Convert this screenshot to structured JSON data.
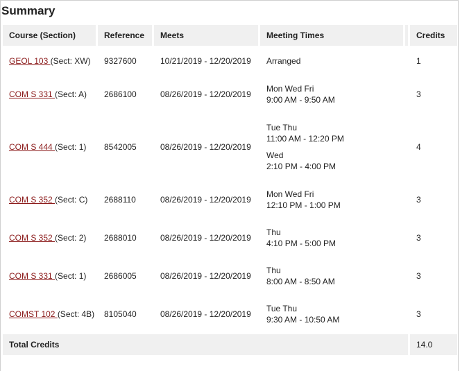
{
  "summary": {
    "title": "Summary",
    "columns": {
      "course": "Course (Section)",
      "reference": "Reference",
      "meets": "Meets",
      "meeting_times": "Meeting Times",
      "credits": "Credits"
    },
    "rows": [
      {
        "course": "GEOL 103 ",
        "section": "(Sect: XW)",
        "reference": "9327600",
        "meets": "10/21/2019 - 12/20/2019",
        "times": [
          {
            "days": "Arranged",
            "time": ""
          }
        ],
        "credits": "1"
      },
      {
        "course": "COM S 331 ",
        "section": "(Sect: A)",
        "reference": "2686100",
        "meets": "08/26/2019 - 12/20/2019",
        "times": [
          {
            "days": "Mon Wed Fri",
            "time": "9:00 AM - 9:50 AM"
          }
        ],
        "credits": "3"
      },
      {
        "course": "COM S 444 ",
        "section": "(Sect: 1)",
        "reference": "8542005",
        "meets": "08/26/2019 - 12/20/2019",
        "times": [
          {
            "days": "Tue Thu",
            "time": "11:00 AM - 12:20 PM"
          },
          {
            "days": "Wed",
            "time": "2:10 PM - 4:00 PM"
          }
        ],
        "credits": "4"
      },
      {
        "course": "COM S 352 ",
        "section": "(Sect: C)",
        "reference": "2688110",
        "meets": "08/26/2019 - 12/20/2019",
        "times": [
          {
            "days": "Mon Wed Fri",
            "time": "12:10 PM - 1:00 PM"
          }
        ],
        "credits": "3"
      },
      {
        "course": "COM S 352 ",
        "section": "(Sect: 2)",
        "reference": "2688010",
        "meets": "08/26/2019 - 12/20/2019",
        "times": [
          {
            "days": "Thu",
            "time": "4:10 PM - 5:00 PM"
          }
        ],
        "credits": "3"
      },
      {
        "course": "COM S 331 ",
        "section": "(Sect: 1)",
        "reference": "2686005",
        "meets": "08/26/2019 - 12/20/2019",
        "times": [
          {
            "days": "Thu",
            "time": "8:00 AM - 8:50 AM"
          }
        ],
        "credits": "3"
      },
      {
        "course": "COMST 102 ",
        "section": "(Sect: 4B)",
        "reference": "8105040",
        "meets": "08/26/2019 - 12/20/2019",
        "times": [
          {
            "days": "Tue Thu",
            "time": "9:30 AM - 10:50 AM"
          }
        ],
        "credits": "3"
      }
    ],
    "total_label": "Total Credits",
    "total_credits": "14.0"
  },
  "colors": {
    "link": "#8b1a1a",
    "header_bg": "#f0f0f0"
  }
}
